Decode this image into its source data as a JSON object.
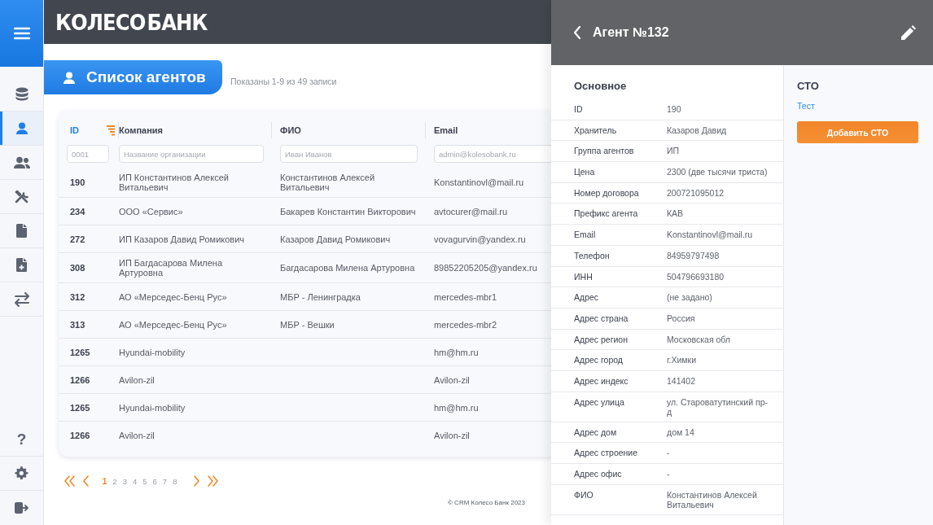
{
  "sidebar": {
    "items": [
      {
        "kind": "database",
        "selected": false
      },
      {
        "kind": "user",
        "selected": true
      },
      {
        "kind": "users",
        "selected": false
      },
      {
        "kind": "tools",
        "selected": false
      },
      {
        "kind": "document",
        "selected": false
      },
      {
        "kind": "document-add",
        "selected": false
      },
      {
        "kind": "exchange",
        "selected": false
      }
    ],
    "bottom_items": [
      {
        "kind": "help",
        "label": "?"
      },
      {
        "kind": "gear"
      },
      {
        "kind": "logout"
      }
    ]
  },
  "header": {
    "logo": "КОЛЕСО БАНК"
  },
  "page_title": "Список агентов",
  "record_count": "Показаны 1-9 из 49 записи",
  "table": {
    "columns": [
      {
        "label": "ID",
        "sorted": true,
        "placeholder": "0001"
      },
      {
        "label": "Компания",
        "sorted": false,
        "placeholder": "Название организации"
      },
      {
        "label": "ФИО",
        "sorted": false,
        "placeholder": "Иван Иванов"
      },
      {
        "label": "Email",
        "sorted": false,
        "placeholder": "admin@kolesobank.ru"
      }
    ],
    "rows": [
      {
        "id": "190",
        "company": "ИП Константинов Алексей Витальевич",
        "fio": "Константинов Алексей Витальевич",
        "email": "Konstantinovl@mail.ru"
      },
      {
        "id": "234",
        "company": "ООО «Сервис»",
        "fio": "Бакарев Константин Викторович",
        "email": "avtocurer@mail.ru"
      },
      {
        "id": "272",
        "company": "ИП Казаров Давид Ромикович",
        "fio": "Казаров Давид Ромикович",
        "email": "vovagurvin@yandex.ru"
      },
      {
        "id": "308",
        "company": "ИП Багдасарова Милена Артуровна",
        "fio": "Багдасарова Милена Артуровна",
        "email": "89852205205@yandex.ru"
      },
      {
        "id": "312",
        "company": "АО «Мерседес-Бенц Рус»",
        "fio": "МБР - Ленинградка",
        "email": "mercedes-mbr1"
      },
      {
        "id": "313",
        "company": "АО «Мерседес-Бенц Рус»",
        "fio": "МБР - Вешки",
        "email": "mercedes-mbr2"
      },
      {
        "id": "1265",
        "company": "Hyundai-mobility",
        "email": "hm@hm.ru"
      },
      {
        "id": "1266",
        "company": "Avilon-zil",
        "email": "Avilon-zil"
      },
      {
        "id": "1265",
        "company": "Hyundai-mobility",
        "email": "hm@hm.ru"
      },
      {
        "id": "1266",
        "company": "Avilon-zil",
        "email": "Avilon-zil"
      }
    ]
  },
  "pagination": {
    "pages": [
      {
        "label": "1",
        "selected": true
      },
      {
        "label": "2",
        "selected": false
      },
      {
        "label": "3",
        "selected": false
      },
      {
        "label": "4",
        "selected": false
      },
      {
        "label": "5",
        "selected": false
      },
      {
        "label": "6",
        "selected": false
      },
      {
        "label": "7",
        "selected": false
      },
      {
        "label": "8",
        "selected": false
      }
    ]
  },
  "footer": "© CRM Колесо Банк 2023",
  "panel": {
    "title": "Агент №132",
    "section_title": "Основное",
    "fields": [
      {
        "label": "ID",
        "value": "190"
      },
      {
        "label": "Хранитель",
        "value": "Казаров Давид"
      },
      {
        "label": "Группа агентов",
        "value": "ИП"
      },
      {
        "label": "Цена",
        "value": "2300 (две тысячи триста)"
      },
      {
        "label": "Номер договора",
        "value": "200721095012"
      },
      {
        "label": "Префикс агента",
        "value": "КАВ"
      },
      {
        "label": "Email",
        "value": "Konstantinovl@mail.ru"
      },
      {
        "label": "Телефон",
        "value": "84959797498"
      },
      {
        "label": "ИНН",
        "value": "504796693180"
      },
      {
        "label": "Адрес",
        "value": "(не задано)"
      },
      {
        "label": "Адрес страна",
        "value": "Россия"
      },
      {
        "label": "Адрес регион",
        "value": "Московская обл"
      },
      {
        "label": "Адрес город",
        "value": "г.Химки"
      },
      {
        "label": "Адрес индекс",
        "value": "141402"
      },
      {
        "label": "Адрес улица",
        "value": "ул. Староватутинский пр-д"
      },
      {
        "label": "Адрес дом",
        "value": "дом 14"
      },
      {
        "label": "Адрес строение",
        "value": "-"
      },
      {
        "label": "Адрес офис",
        "value": "-"
      },
      {
        "label": "ФИО",
        "value": "Константинов Алексей Витальевич"
      }
    ],
    "side": {
      "title": "СТО",
      "links": [
        "Тест"
      ],
      "button": "Добавить СТО"
    }
  }
}
